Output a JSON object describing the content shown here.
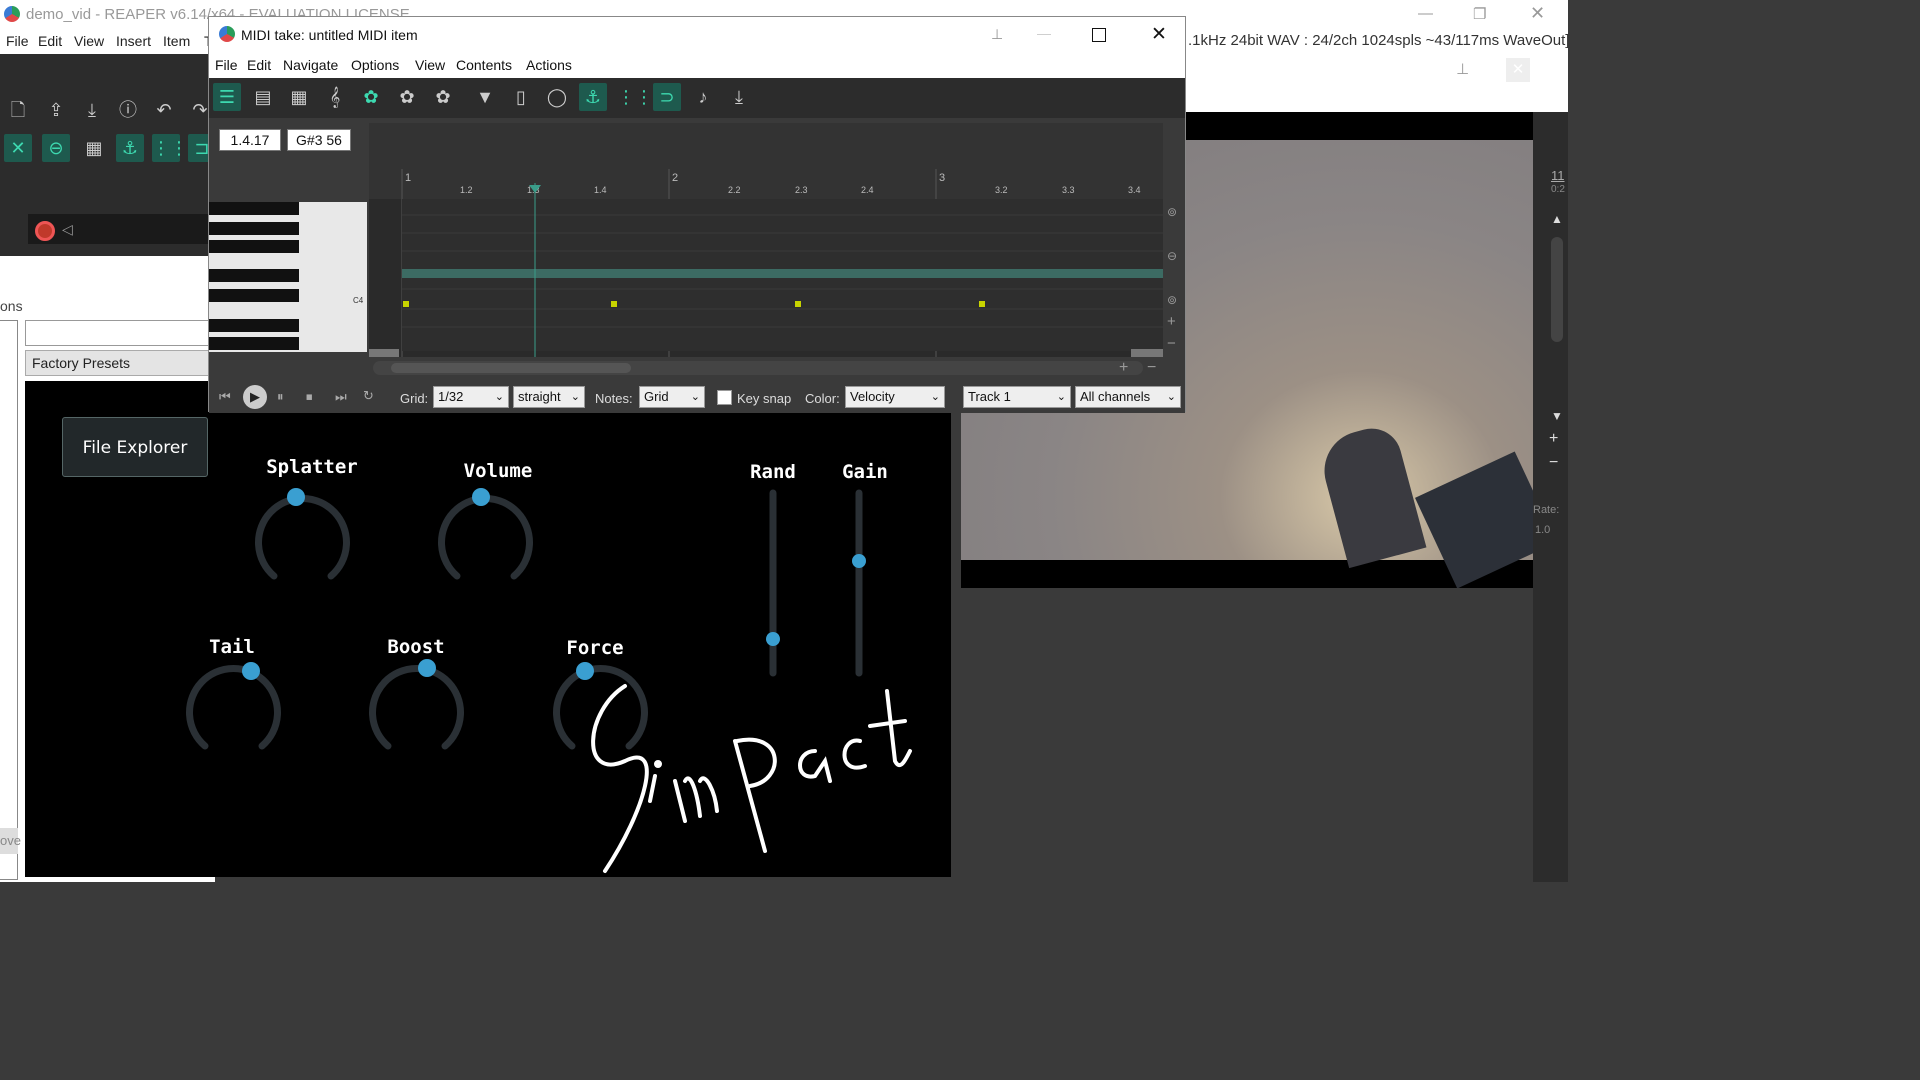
{
  "reaper": {
    "title": "demo_vid - REAPER v6.14/x64 - EVALUATION LICENSE",
    "menu": [
      "File",
      "Edit",
      "View",
      "Insert",
      "Item",
      "T"
    ],
    "audio_info": ".1kHz 24bit WAV : 24/2ch 1024spls ~43/117ms WaveOut]",
    "ons_label": "ons",
    "ove_label": "ove",
    "factory_presets": "Factory Presets"
  },
  "midi_editor": {
    "title": "MIDI take: untitled MIDI item",
    "menu": [
      "File",
      "Edit",
      "Navigate",
      "Options",
      "View",
      "Contents",
      "Actions"
    ],
    "position": "1.4.17",
    "note_info": "G#3  56",
    "piano_c4": "C4",
    "ruler": [
      "1",
      "1.2",
      "1.3",
      "1.4",
      "2",
      "2.2",
      "2.3",
      "2.4",
      "3",
      "3.2",
      "3.3",
      "3.4"
    ],
    "grid_label": "Grid:",
    "grid_value": "1/32",
    "straight": "straight",
    "notes_label": "Notes:",
    "notes_value": "Grid",
    "key_snap": "Key snap",
    "color_label": "Color:",
    "color_value": "Velocity",
    "track": "Track 1",
    "channels": "All channels"
  },
  "plugin": {
    "file_explorer": "File Explorer",
    "knobs": {
      "splatter": "Splatter",
      "volume": "Volume",
      "tail": "Tail",
      "boost": "Boost",
      "force": "Force"
    },
    "sliders": {
      "rand": "Rand",
      "gain": "Gain"
    },
    "logo": "SimPact"
  },
  "side": {
    "rate_label": "Rate:",
    "rate_value": "1.0",
    "num": "11",
    "num2": "0:2"
  },
  "colors": {
    "accent": "#3dd9b0",
    "knob": "#3a9fd1",
    "note": "#c8d400"
  }
}
